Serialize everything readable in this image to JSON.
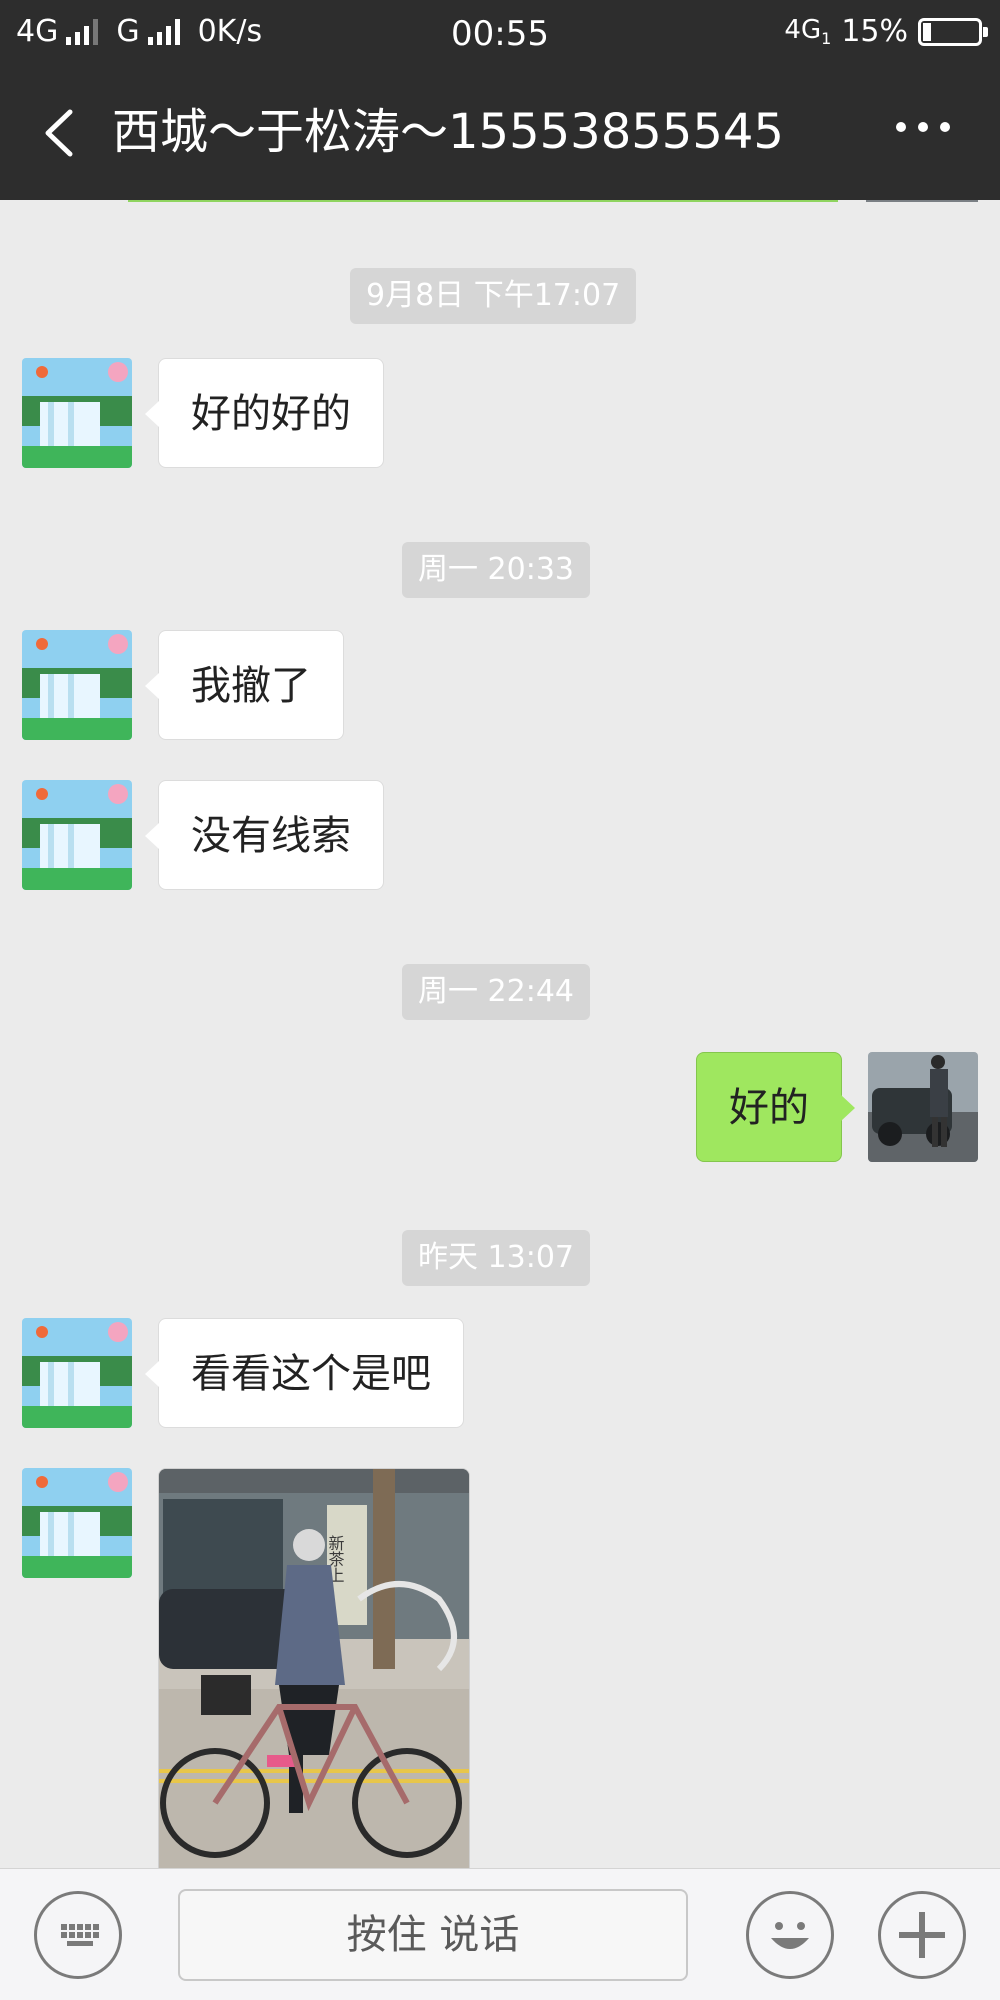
{
  "status": {
    "network1": "4G",
    "network2": "G",
    "speed": "0K/s",
    "time": "00:55",
    "network3": "4G",
    "sim": "1",
    "battery": "15%",
    "battery_level": 0.15
  },
  "nav": {
    "title": "西城～于松涛～15553855545"
  },
  "messages": [
    {
      "timestamp": "9月8日 下午17:07"
    },
    {
      "incoming": "好的好的"
    },
    {
      "timestamp": "周一 20:33"
    },
    {
      "incoming": "我撤了"
    },
    {
      "incoming": "没有线索"
    },
    {
      "timestamp": "周一 22:44"
    },
    {
      "outgoing": "好的"
    },
    {
      "timestamp": "昨天 13:07"
    },
    {
      "incoming": "看看这个是吧"
    },
    {
      "photo_sign": "新茶上"
    }
  ],
  "input": {
    "voice_label": "按住 说话"
  },
  "icons": {
    "back": "chevron-left-icon",
    "more": "more-icon",
    "keyboard": "keyboard-icon",
    "emoji": "emoji-icon",
    "add": "plus-icon"
  }
}
